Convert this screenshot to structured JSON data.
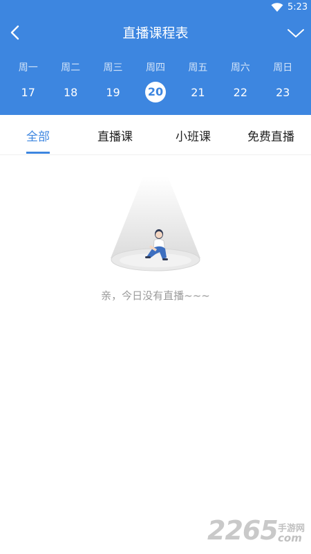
{
  "status_bar": {
    "time": "5:23"
  },
  "nav": {
    "title": "直播课程表"
  },
  "week": {
    "weekdays": [
      "周一",
      "周二",
      "周三",
      "周四",
      "周五",
      "周六",
      "周日"
    ],
    "dates": [
      "17",
      "18",
      "19",
      "20",
      "21",
      "22",
      "23"
    ],
    "selected_index": 3
  },
  "tabs": [
    "全部",
    "直播课",
    "小班课",
    "免费直播"
  ],
  "active_tab_index": 0,
  "empty_state": {
    "message": "亲，今日没有直播~~~"
  },
  "watermark": {
    "number": "2265",
    "text": "手游网",
    "suffix": "com"
  },
  "colors": {
    "primary": "#3d86e0",
    "empty_text": "#9a9a9a",
    "background": "#ffffff"
  }
}
